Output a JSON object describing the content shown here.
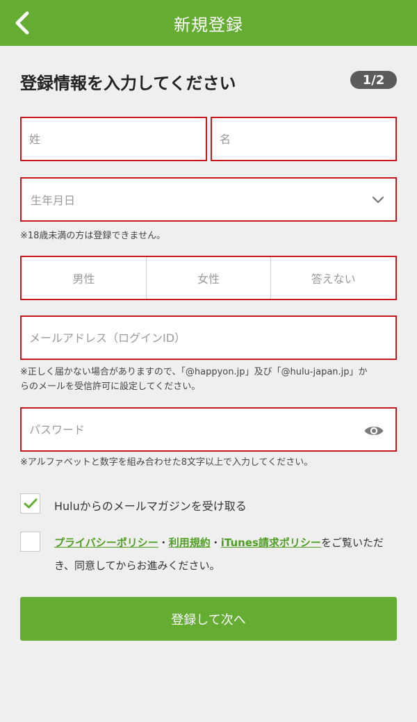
{
  "header": {
    "title": "新規登録",
    "back_icon": "chevron-left-icon"
  },
  "heading": "登録情報を入力してください",
  "step": "1/2",
  "form": {
    "last_name_placeholder": "姓",
    "first_name_placeholder": "名",
    "birthdate_placeholder": "生年月日",
    "birthdate_note": "※18歳未満の方は登録できません。",
    "gender_options": [
      "男性",
      "女性",
      "答えない"
    ],
    "email_placeholder": "メールアドレス（ログインID）",
    "email_note_line1": "※正しく届かない場合がありますので、「@happyon.jp」及び「@hulu-japan.jp」か",
    "email_note_line2": "らのメールを受信許可に設定してください。",
    "password_placeholder": "パスワード",
    "password_note": "※アルファベットと数字を組み合わせた8文字以上で入力してください。",
    "newsletter_label": "Huluからのメールマガジンを受け取る",
    "newsletter_checked": true,
    "terms_checked": false,
    "terms": {
      "privacy_link": "プライバシーポリシー",
      "sep1": "・",
      "terms_link": "利用規約",
      "sep2": "・",
      "itunes_link": "iTunes請求ポリシー",
      "rest_line1": "をご覧いただ",
      "rest_line2": "き、同意してからお進みください。"
    },
    "submit_label": "登録して次へ"
  },
  "colors": {
    "brand": "#65ad32",
    "error_border": "#c8161d",
    "link": "#4f9e22"
  }
}
